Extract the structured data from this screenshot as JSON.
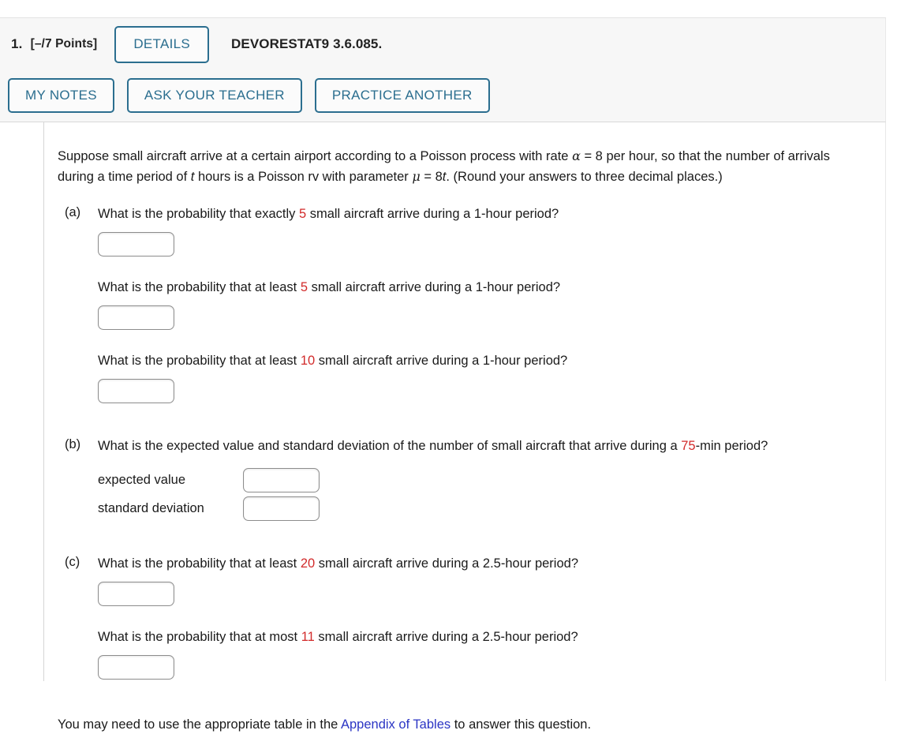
{
  "header": {
    "question_number": "1.",
    "points": "[–/7 Points]",
    "details_label": "DETAILS",
    "question_code": "DEVORESTAT9 3.6.085.",
    "buttons": [
      {
        "label": "MY NOTES"
      },
      {
        "label": "ASK YOUR TEACHER"
      },
      {
        "label": "PRACTICE ANOTHER"
      }
    ]
  },
  "problem": {
    "intro_1": "Suppose small aircraft arrive at a certain airport according to a Poisson process with rate ",
    "alpha_symbol": "α",
    "intro_2": " = 8 per hour, so that the number of arrivals during a time period of ",
    "t_symbol_1": "t",
    "intro_3": " hours is a Poisson rv with parameter ",
    "mu_symbol": "μ",
    "intro_4": " = 8",
    "t_symbol_2": "t",
    "intro_5": ". (Round your answers to three decimal places.)"
  },
  "parts": {
    "a": {
      "label": "(a)",
      "q1_pre": "What is the probability that exactly ",
      "q1_value": "5",
      "q1_post": " small aircraft arrive during a 1-hour period?",
      "q2_pre": "What is the probability that at least ",
      "q2_value": "5",
      "q2_post": " small aircraft arrive during a 1-hour period?",
      "q3_pre": "What is the probability that at least ",
      "q3_value": "10",
      "q3_post": " small aircraft arrive during a 1-hour period?",
      "answer_1": "",
      "answer_2": "",
      "answer_3": ""
    },
    "b": {
      "label": "(b)",
      "q_pre": "What is the expected value and standard deviation of the number of small aircraft that arrive during a ",
      "q_value": "75",
      "q_post": "-min period?",
      "expected_value_label": "expected value",
      "standard_deviation_label": "standard deviation",
      "expected_value_answer": "",
      "standard_deviation_answer": ""
    },
    "c": {
      "label": "(c)",
      "q1_pre": "What is the probability that at least ",
      "q1_value": "20",
      "q1_post": " small aircraft arrive during a 2.5-hour period?",
      "q2_pre": "What is the probability that at most ",
      "q2_value": "11",
      "q2_post": " small aircraft arrive during a 2.5-hour period?",
      "answer_1": "",
      "answer_2": ""
    }
  },
  "footer": {
    "note_pre": "You may need to use the appropriate table in the ",
    "link_label": "Appendix of Tables",
    "note_post": " to answer this question."
  },
  "colors": {
    "accent_blue": "#2b6e8f",
    "parameter_red": "#d22b2b",
    "link_blue": "#2b35c4",
    "header_background": "#f7f7f7"
  }
}
